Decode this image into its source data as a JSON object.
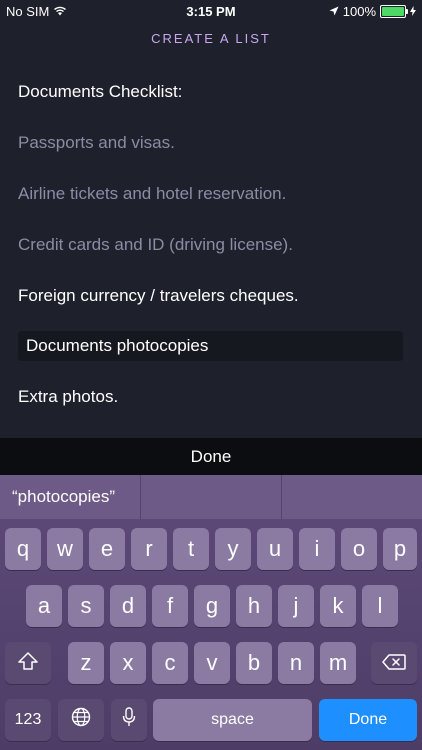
{
  "status": {
    "carrier": "No SIM",
    "time": "3:15 PM",
    "battery_percent": "100%",
    "battery_level": 1.0
  },
  "header": {
    "title": "CREATE A LIST"
  },
  "list": {
    "items": [
      "Documents Checklist:",
      "Passports and visas.",
      "Airline tickets and hotel reservation.",
      "Credit cards and ID (driving license).",
      "Foreign currency / travelers cheques.",
      "Documents photocopies",
      "Extra photos."
    ]
  },
  "toolbar": {
    "done_label": "Done"
  },
  "keyboard": {
    "suggestions": [
      "“photocopies”",
      "",
      ""
    ],
    "row1": [
      "q",
      "w",
      "e",
      "r",
      "t",
      "y",
      "u",
      "i",
      "o",
      "p"
    ],
    "row2": [
      "a",
      "s",
      "d",
      "f",
      "g",
      "h",
      "j",
      "k",
      "l"
    ],
    "row3": [
      "z",
      "x",
      "c",
      "v",
      "b",
      "n",
      "m"
    ],
    "numbers_label": "123",
    "space_label": "space",
    "done_label": "Done"
  },
  "colors": {
    "background": "#1e212b",
    "title_accent": "#c9a7f0",
    "dim_text": "#8c8ba6",
    "keyboard_bg": "#5e4a7a",
    "done_key": "#1e8fff"
  }
}
